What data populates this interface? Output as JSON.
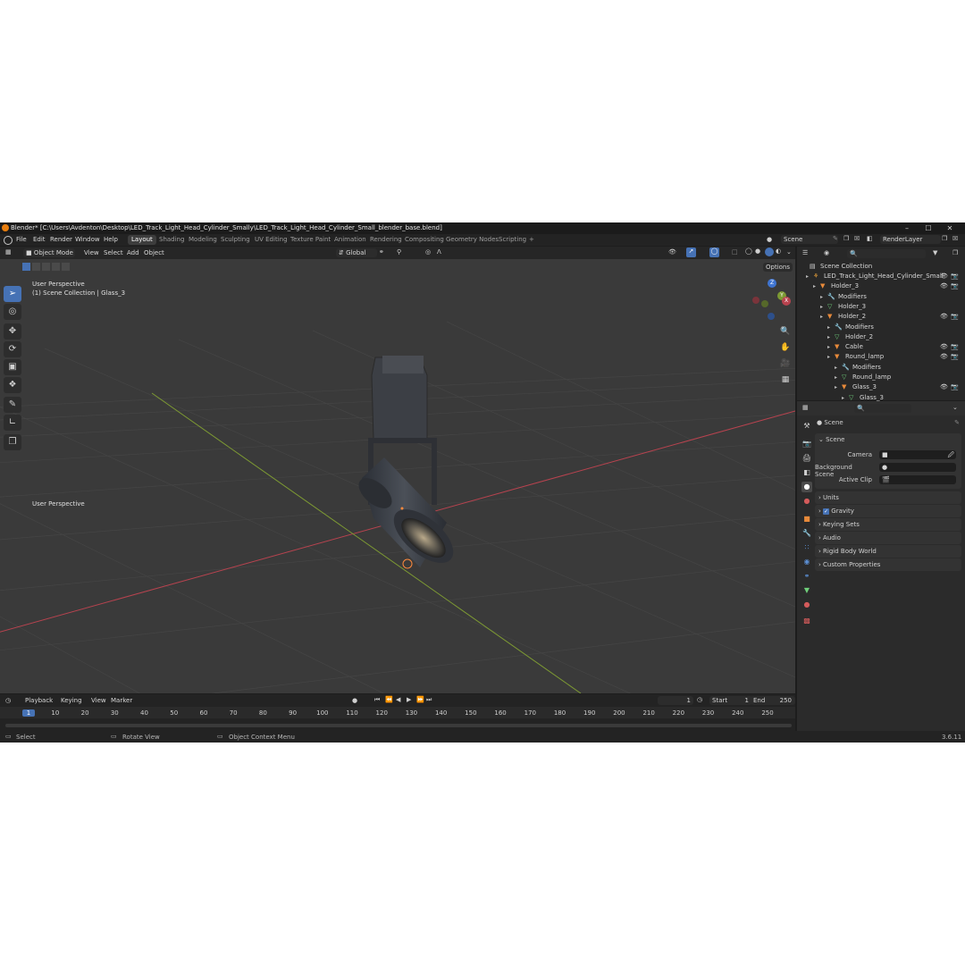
{
  "window": {
    "title": "Blender* [C:\\Users\\Avdenton\\Desktop\\LED_Track_Light_Head_Cylinder_Smally\\LED_Track_Light_Head_Cylinder_Small_blender_base.blend]",
    "minimize": "–",
    "maximize": "☐",
    "close": "✕"
  },
  "menu": {
    "items": [
      "File",
      "Edit",
      "Render",
      "Window",
      "Help"
    ]
  },
  "workspaces": [
    "Layout",
    "Shading",
    "Modeling",
    "Sculpting",
    "UV Editing",
    "Texture Paint",
    "Animation",
    "Rendering",
    "Compositing",
    "Geometry Nodes",
    "Scripting"
  ],
  "workspace_add": "+",
  "scene": {
    "name": "Scene",
    "view_layer": "RenderLayer"
  },
  "viewport_header": {
    "mode": "Object Mode",
    "menus": [
      "View",
      "Select",
      "Add",
      "Object"
    ],
    "orientation": "Global",
    "options": "Options"
  },
  "viewport": {
    "view_name": "User Perspective",
    "collection_info": "(1) Scene Collection | Glass_3",
    "colors": {
      "x_axis": "#b8434f",
      "y_axis": "#7d9a33",
      "z_axis": "#3f74d0",
      "select": "#ff8a3d"
    }
  },
  "gizmo": {
    "x": "X",
    "y": "Y",
    "z": "Z"
  },
  "outliner": {
    "root": "Scene Collection",
    "rows": [
      {
        "label": "LED_Track_Light_Head_Cylinder_Small",
        "icon": "armature-icon"
      },
      {
        "label": "Holder_3",
        "icon": "mesh-object-icon"
      },
      {
        "label": "Modifiers",
        "icon": "wrench-icon"
      },
      {
        "label": "Holder_3",
        "icon": "mesh-data-icon"
      },
      {
        "label": "Holder_2",
        "icon": "mesh-object-icon"
      },
      {
        "label": "Modifiers",
        "icon": "wrench-icon"
      },
      {
        "label": "Holder_2",
        "icon": "mesh-data-icon"
      },
      {
        "label": "Cable",
        "icon": "mesh-object-icon"
      },
      {
        "label": "Round_lamp",
        "icon": "mesh-object-icon"
      },
      {
        "label": "Modifiers",
        "icon": "wrench-icon"
      },
      {
        "label": "Round_lamp",
        "icon": "mesh-data-icon"
      },
      {
        "label": "Glass_3",
        "icon": "mesh-object-icon"
      },
      {
        "label": "Glass_3",
        "icon": "mesh-data-icon"
      }
    ]
  },
  "properties": {
    "header": "Scene",
    "panel": "Scene",
    "fields": [
      {
        "label": "Camera"
      },
      {
        "label": "Background Scene"
      },
      {
        "label": "Active Clip"
      }
    ],
    "panels": [
      "Units",
      "Gravity",
      "Keying Sets",
      "Audio",
      "Rigid Body World",
      "Custom Properties"
    ]
  },
  "timeline": {
    "menus": [
      "Playback",
      "Keying",
      "View",
      "Marker"
    ],
    "current_frame": "1",
    "start_label": "Start",
    "start": "1",
    "end_label": "End",
    "end": "250",
    "ticks": [
      "1",
      "10",
      "20",
      "30",
      "40",
      "50",
      "60",
      "70",
      "80",
      "90",
      "100",
      "110",
      "120",
      "130",
      "140",
      "150",
      "160",
      "170",
      "180",
      "190",
      "200",
      "210",
      "220",
      "230",
      "240",
      "250"
    ]
  },
  "statusbar": {
    "select": "Select",
    "rotate": "Rotate View",
    "context": "Object Context Menu",
    "version": "3.6.11"
  }
}
